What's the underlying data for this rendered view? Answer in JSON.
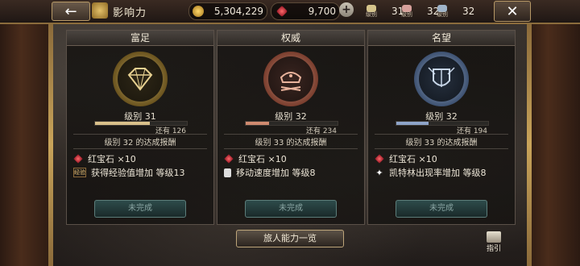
{
  "header": {
    "title": "影响力",
    "gold": "5,304,229",
    "gems": "9,700",
    "level_stats": [
      {
        "label": "级别",
        "value": "31",
        "color": "#d6c48b"
      },
      {
        "label": "级别",
        "value": "32",
        "color": "#d7a09b"
      },
      {
        "label": "级别",
        "value": "32",
        "color": "#9fb4c9"
      }
    ]
  },
  "cards": [
    {
      "title": "富足",
      "level_text": "级别 31",
      "rest_text": "还有 126",
      "progress": 0.6,
      "bar_color": "#d9c08a",
      "reward_title": "级别 32 的达成报酬",
      "reward1": "红宝石 ×10",
      "reward2": "获得经验值增加  等级13",
      "reward2_icon_text": "经验",
      "button": "未完成"
    },
    {
      "title": "权威",
      "level_text": "级别 32",
      "rest_text": "还有 234",
      "progress": 0.25,
      "bar_color": "#cf8a6f",
      "reward_title": "级别 33 的达成报酬",
      "reward1": "红宝石 ×10",
      "reward2": "移动速度增加  等级8",
      "button": "未完成"
    },
    {
      "title": "名望",
      "level_text": "级别 32",
      "rest_text": "还有 194",
      "progress": 0.35,
      "bar_color": "#8ea4c8",
      "reward_title": "级别 33 的达成报酬",
      "reward1": "红宝石 ×10",
      "reward2": "凯特林出现率增加  等级8",
      "button": "未完成"
    }
  ],
  "footer": {
    "ability_button": "旅人能力一览",
    "guide_label": "指引"
  },
  "colors": {
    "accent_gold": "#b69866",
    "gem_red": "#c1192d"
  }
}
